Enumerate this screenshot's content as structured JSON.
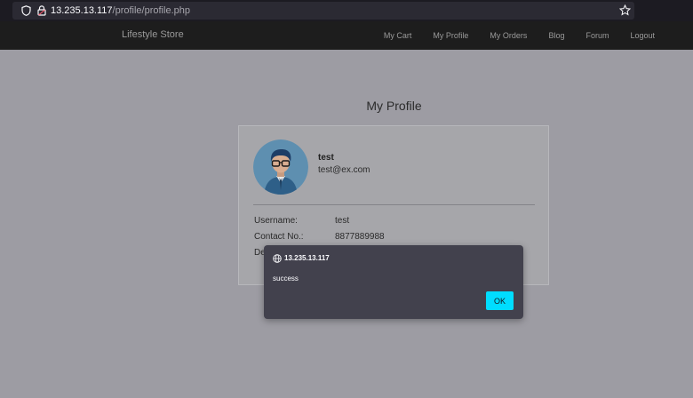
{
  "browser": {
    "url_host": "13.235.13.117",
    "url_path": "/profile/profile.php",
    "icons": [
      "shield-icon",
      "lock-icon",
      "star-icon"
    ]
  },
  "nav": {
    "brand": "Lifestyle Store",
    "links": [
      "My Cart",
      "My Profile",
      "My Orders",
      "Blog",
      "Forum",
      "Logout"
    ]
  },
  "profile": {
    "title": "My Profile",
    "name": "test",
    "email": "test@ex.com",
    "username_label": "Username:",
    "username_value": "test",
    "contact_label": "Contact No.:",
    "contact_value": "8877889988",
    "third_label_partial": "De"
  },
  "dialog": {
    "origin": "13.235.13.117",
    "message": "success",
    "ok_label": "OK"
  },
  "colors": {
    "overlay_background": "#9d9ca3",
    "nav_background": "#1d1d1d",
    "dialog_background": "#42414d",
    "ok_button": "#00ddff"
  }
}
